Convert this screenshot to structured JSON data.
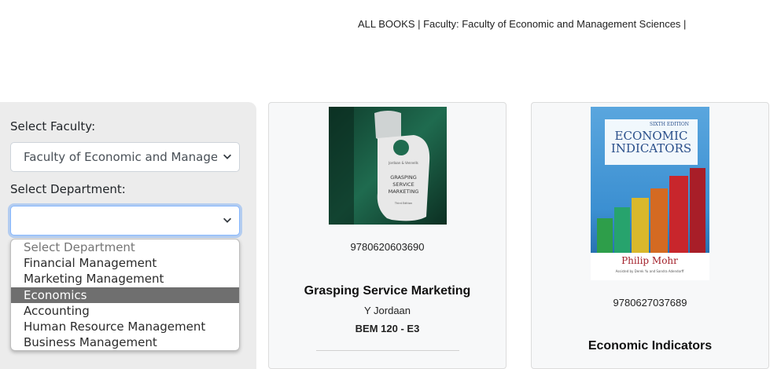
{
  "breadcrumb": "ALL BOOKS | Faculty: Faculty of Economic and Management Sciences |",
  "sidebar": {
    "faculty_label": "Select Faculty:",
    "faculty_value": "Faculty of Economic and Management Sciences",
    "department_label": "Select Department:",
    "department_value": "",
    "department_options": [
      "Select Department",
      "Financial Management",
      "Marketing Management",
      "Economics",
      "Accounting",
      "Human Resource Management",
      "Business Management"
    ],
    "selected_option": "Economics"
  },
  "books": [
    {
      "isbn": "9780620603690",
      "title": "Grasping Service Marketing",
      "author": "Y Jordaan",
      "code": "BEM 120 - E3",
      "cover": {
        "icon": "door-hanger-cover",
        "text_lines": [
          "GRASPING",
          "SERVICE",
          "MARKETING"
        ],
        "top_text": "Jordaan & Vennells",
        "edition": "Third Edition",
        "colors": {
          "background": "#1f6b4f",
          "hanger": "#e8e8e8"
        }
      }
    },
    {
      "isbn": "9780627037689",
      "title": "Economic Indicators",
      "cover": {
        "icon": "bar-chart-cover",
        "edition": "SIXTH EDITION",
        "line1": "ECONOMIC",
        "line2": "INDICATORS",
        "author": "Philip Mohr",
        "assist": "Assisted by Derek Yu and Sandra Adendorff",
        "colors": {
          "background": "#3b8fd1",
          "title": "#2a4f8a",
          "author": "#a3202a"
        }
      }
    }
  ]
}
